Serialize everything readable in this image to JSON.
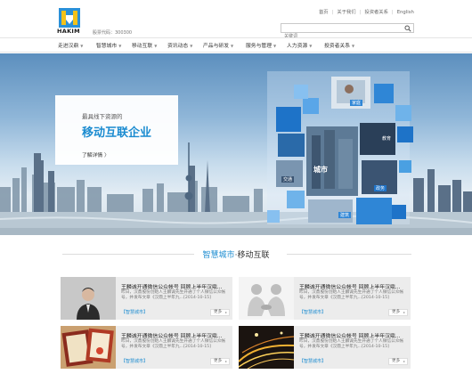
{
  "brand": {
    "logo_text": "HAKIM",
    "stock_code": "股票代码：300300"
  },
  "top_links": [
    "首页",
    "关于我们",
    "投资者关系",
    "English"
  ],
  "search": {
    "placeholder": "关键词"
  },
  "nav": [
    {
      "label": "走进汉鼎"
    },
    {
      "label": "智慧城市"
    },
    {
      "label": "移动互联"
    },
    {
      "label": "资讯动态"
    },
    {
      "label": "产品与研发"
    },
    {
      "label": "服务与管理"
    },
    {
      "label": "人力资源"
    },
    {
      "label": "投资者关系"
    }
  ],
  "banner": {
    "small": "最具线下资源的",
    "big": "移动互联企业",
    "link": "了解详情 〉",
    "cube_labels": [
      "城市",
      "家庭",
      "教育",
      "交通",
      "政务",
      "建筑"
    ]
  },
  "section": {
    "title_hl": "智慧城市",
    "title_sep": "·",
    "title_rest": "移动互联"
  },
  "news": [
    {
      "title": "王麟诚开通微信公众帐号 回顾上半年汉鼎...",
      "summary": "昨日，汉鼎股份创始人王麟诚先生开通了个人微信公众帐号，并发布文章《汉鼎上半年九...[2014-10-15]",
      "tag": "【智慧城市】",
      "more": "更多"
    },
    {
      "title": "王麟诚开通微信公众帐号 回顾上半年汉鼎...",
      "summary": "昨日，汉鼎股份创始人王麟诚先生开通了个人微信公众帐号，并发布文章《汉鼎上半年九...[2014-10-15]",
      "tag": "【智慧城市】",
      "more": "更多"
    },
    {
      "title": "王麟诚开通微信公众帐号 回顾上半年汉鼎...",
      "summary": "昨日，汉鼎股份创始人王麟诚先生开通了个人微信公众帐号，并发布文章《汉鼎上半年九...[2014-10-15]",
      "tag": "【智慧城市】",
      "more": "更多"
    },
    {
      "title": "王麟诚开通微信公众帐号 回顾上半年汉鼎...",
      "summary": "昨日，汉鼎股份创始人王麟诚先生开通了个人微信公众帐号，并发布文章《汉鼎上半年九...[2014-10-15]",
      "tag": "【智慧城市】",
      "more": "更多"
    }
  ],
  "colors": {
    "accent": "#1a8bd0",
    "card_bg": "#ececec",
    "nav_border": "#e4e4e4"
  }
}
